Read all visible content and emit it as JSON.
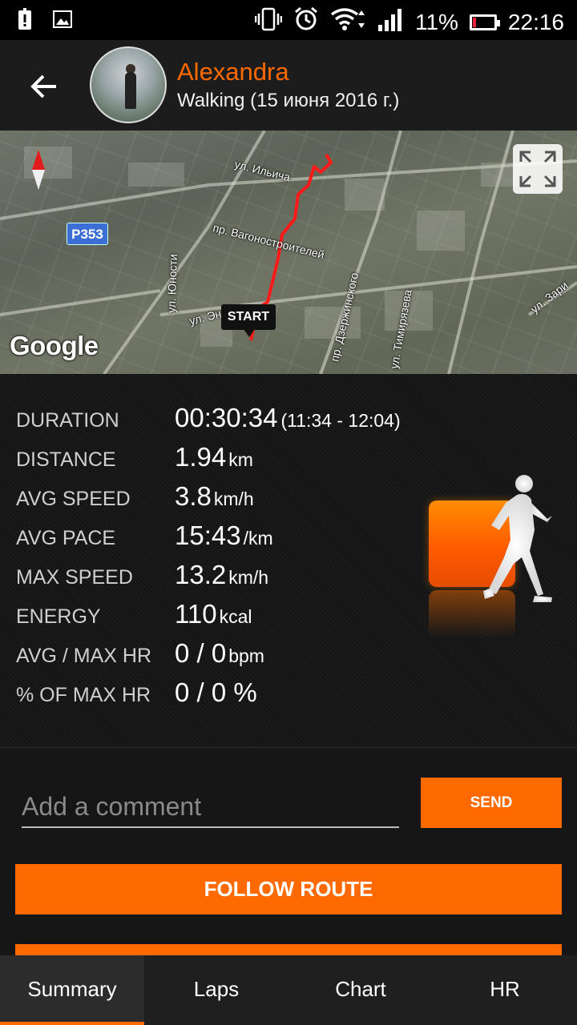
{
  "status_bar": {
    "battery_percent": "11%",
    "time": "22:16",
    "icons": [
      "alert-icon",
      "image-icon",
      "vibrate-icon",
      "alarm-icon",
      "wifi-icon",
      "signal-icon",
      "battery-icon"
    ]
  },
  "header": {
    "name": "Alexandra",
    "subtitle": "Walking (15 июня 2016 г.)"
  },
  "map": {
    "labels": {
      "ilyicha": "ул. Ильича",
      "vagon": "пр. Вагоностроителей",
      "yunosti": "ул. Юности",
      "en": "ул. Эн",
      "dzerzh": "пр. Дзержинского",
      "timir": "ул. Тимирязева",
      "zari": "ул. Зари"
    },
    "road_sign": "P353",
    "start_label": "START",
    "provider": "Google"
  },
  "stats": [
    {
      "label": "DURATION",
      "value": "00:30:34",
      "unit": "",
      "extra": "(11:34 - 12:04)"
    },
    {
      "label": "DISTANCE",
      "value": "1.94",
      "unit": "km",
      "extra": ""
    },
    {
      "label": "AVG SPEED",
      "value": "3.8",
      "unit": "km/h",
      "extra": ""
    },
    {
      "label": "AVG PACE",
      "value": "15:43",
      "unit": "/km",
      "extra": ""
    },
    {
      "label": "MAX SPEED",
      "value": "13.2",
      "unit": "km/h",
      "extra": ""
    },
    {
      "label": "ENERGY",
      "value": "110",
      "unit": "kcal",
      "extra": ""
    },
    {
      "label": "AVG / MAX HR",
      "value": "0 / 0",
      "unit": "bpm",
      "extra": ""
    },
    {
      "label": "% OF MAX HR",
      "value": "0 / 0 %",
      "unit": "",
      "extra": ""
    }
  ],
  "comment": {
    "placeholder": "Add a comment",
    "value": "",
    "send_label": "SEND"
  },
  "follow_label": "FOLLOW ROUTE",
  "tabs": [
    {
      "label": "Summary",
      "active": true
    },
    {
      "label": "Laps",
      "active": false
    },
    {
      "label": "Chart",
      "active": false
    },
    {
      "label": "HR",
      "active": false
    }
  ],
  "colors": {
    "accent": "#ff6a00",
    "route": "#ff1a1a"
  }
}
